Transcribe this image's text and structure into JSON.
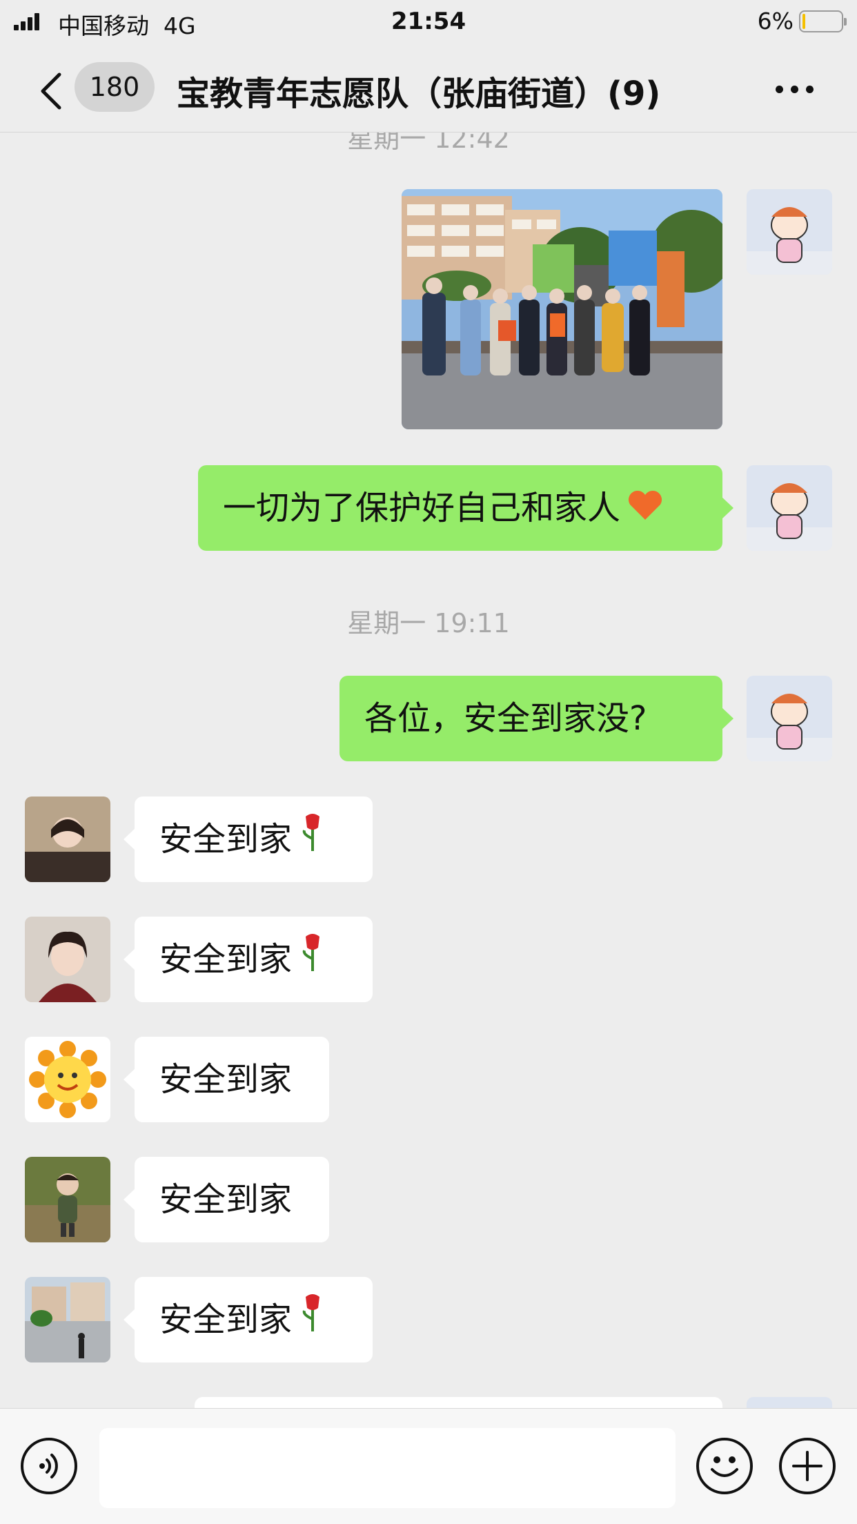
{
  "status_bar": {
    "carrier": "中国移动",
    "network": "4G",
    "time": "21:54",
    "battery_percent": "6%",
    "battery_level": 0.06,
    "battery_fill_color": "#f5c000"
  },
  "nav": {
    "back_icon": "chevron-left-icon",
    "unread_count": "180",
    "title": "宝教青年志愿队（张庙街道）(9)",
    "more_icon": "ellipsis-icon"
  },
  "chat": {
    "messages": [
      {
        "type": "timestamp",
        "text": "星期一 12:42"
      },
      {
        "type": "image",
        "direction": "outgoing",
        "description_icon": "group-photo-image"
      },
      {
        "type": "text",
        "direction": "outgoing",
        "text": "一切为了保护好自己和家人",
        "emoji": "heart-emoji"
      },
      {
        "type": "timestamp",
        "text": "星期一 19:11"
      },
      {
        "type": "text",
        "direction": "outgoing",
        "text": "各位，安全到家没?"
      },
      {
        "type": "text",
        "direction": "incoming",
        "text": "安全到家",
        "emoji": "rose-emoji"
      },
      {
        "type": "text",
        "direction": "incoming",
        "text": "安全到家",
        "emoji": "rose-emoji"
      },
      {
        "type": "text",
        "direction": "incoming",
        "text": "安全到家"
      },
      {
        "type": "text",
        "direction": "incoming",
        "text": "安全到家"
      },
      {
        "type": "text",
        "direction": "incoming",
        "text": "安全到家",
        "emoji": "rose-emoji"
      }
    ],
    "bubble_colors": {
      "outgoing": "#95ec69",
      "incoming": "#ffffff"
    }
  },
  "input_bar": {
    "voice_icon": "voice-icon",
    "message_value": "",
    "emoji_icon": "smiley-icon",
    "plus_icon": "plus-icon"
  }
}
